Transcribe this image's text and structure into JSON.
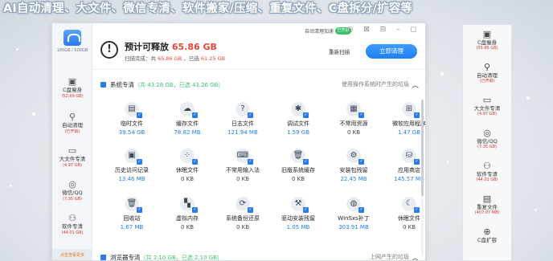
{
  "banner": "AI自动清理、大文件、微信专清、软件搬家/压缩、重复文件、C盘拆分/扩容等",
  "app": {
    "logo_caption": "180GB / 500GB",
    "titlebar": {
      "auto_clean_label": "自动清理加速",
      "toggle_label": "已开启",
      "window_icons": "◎ ⊠ ⊟ – ◻"
    },
    "header": {
      "title_prefix": "预计可释放",
      "title_size": "65.86 GB",
      "sub_prefix": "扫描完成：共",
      "sub_total": "65.86 GB",
      "sub_mid": "，已选",
      "sub_selected": "61.25 GB",
      "rescan_label": "重新扫描",
      "clean_button": "立即清理"
    },
    "sidebar": [
      {
        "label": "C盘瘦身",
        "sub": "(52.69 GB)",
        "icon": "disk-icon"
      },
      {
        "label": "自动清理",
        "sub": "(已开启)",
        "icon": "broom-icon"
      },
      {
        "label": "大文件专清",
        "sub": "(4.97 GB)",
        "icon": "folder-icon"
      },
      {
        "label": "微信/QQ",
        "sub": "(7.35 GB)",
        "icon": "chat-icon"
      },
      {
        "label": "软件专清",
        "sub": "(44.01 GB)",
        "icon": "apps-icon"
      }
    ],
    "sidebar_footer": "点击查看更多",
    "section1": {
      "title": "系统专清",
      "meta": "（共 43.28 GB，已选 43.26 GB）",
      "right": "使用操作系统时产生的垃圾"
    },
    "tiles": [
      {
        "name": "临时文件",
        "size": "39.54 GB",
        "icon": "document-icon",
        "glyph": "▤"
      },
      {
        "name": "缓存文件",
        "size": "78.82 MB",
        "icon": "cloud-icon",
        "glyph": "☁"
      },
      {
        "name": "日志文件",
        "size": "121.94 MB",
        "icon": "log-icon",
        "glyph": "?"
      },
      {
        "name": "调试文件",
        "size": "1.59 GB",
        "icon": "bug-icon",
        "glyph": "✱"
      },
      {
        "name": "不常用资源",
        "size": "0 KB",
        "icon": "resource-icon",
        "glyph": "▦"
      },
      {
        "name": "微软应用程序",
        "size": "1.47 GB",
        "icon": "windows-icon",
        "glyph": "⊞"
      },
      {
        "name": "历史访问记录",
        "size": "13.46 MB",
        "icon": "history-icon",
        "glyph": "▣"
      },
      {
        "name": "休眠文件",
        "size": "0 KB",
        "icon": "sleep-grid-icon",
        "glyph": "⁘"
      },
      {
        "name": "不常用输入法",
        "size": "0 KB",
        "icon": "keyboard-icon",
        "glyph": "⌨"
      },
      {
        "name": "旧版系统缓存",
        "size": "0 KB",
        "icon": "trash-icon",
        "glyph": "🗑"
      },
      {
        "name": "安装包残留",
        "size": "22.45 MB",
        "icon": "package-icon",
        "glyph": "⚙"
      },
      {
        "name": "应用商店",
        "size": "145.57 MB",
        "icon": "store-icon",
        "glyph": "⛁"
      },
      {
        "name": "回收站",
        "size": "1.67 MB",
        "icon": "recycle-bin-icon",
        "glyph": "🗑"
      },
      {
        "name": "虚拟内存",
        "size": "0 KB",
        "icon": "memory-icon",
        "glyph": "▚"
      },
      {
        "name": "系统备份还原",
        "size": "0 KB",
        "icon": "backup-icon",
        "glyph": "⟳"
      },
      {
        "name": "驱动安装残留",
        "size": "1.05 MB",
        "icon": "driver-icon",
        "glyph": "⚒"
      },
      {
        "name": "WinSxs补丁",
        "size": "303.91 MB",
        "icon": "patch-icon",
        "glyph": "◍"
      },
      {
        "name": "休眠文件",
        "size": "0 KB",
        "icon": "moon-icon",
        "glyph": "☾"
      }
    ],
    "section2": {
      "title": "浏览器专清",
      "meta": "（共 2.10 GB，已选 2.10 GB）",
      "right": "上网产生的垃圾"
    }
  },
  "right_strip": [
    {
      "label": "C盘瘦身",
      "sub": "(55.86 GB)",
      "icon": "disk-icon"
    },
    {
      "label": "自动清理",
      "sub": "(已开启)",
      "icon": "broom-icon"
    },
    {
      "label": "大文件专清",
      "sub": "(4.97 GB)",
      "icon": "folder-icon"
    },
    {
      "label": "微信/QQ",
      "sub": "(7.35 GB)",
      "icon": "chat-icon"
    },
    {
      "label": "软件专清",
      "sub": "(44.01 GB)",
      "icon": "apps-icon"
    },
    {
      "label": "重复文件",
      "sub": "(407.07 MB)",
      "icon": "duplicate-icon"
    },
    {
      "label": "C盘扩容",
      "sub": "",
      "icon": "expand-icon"
    }
  ]
}
